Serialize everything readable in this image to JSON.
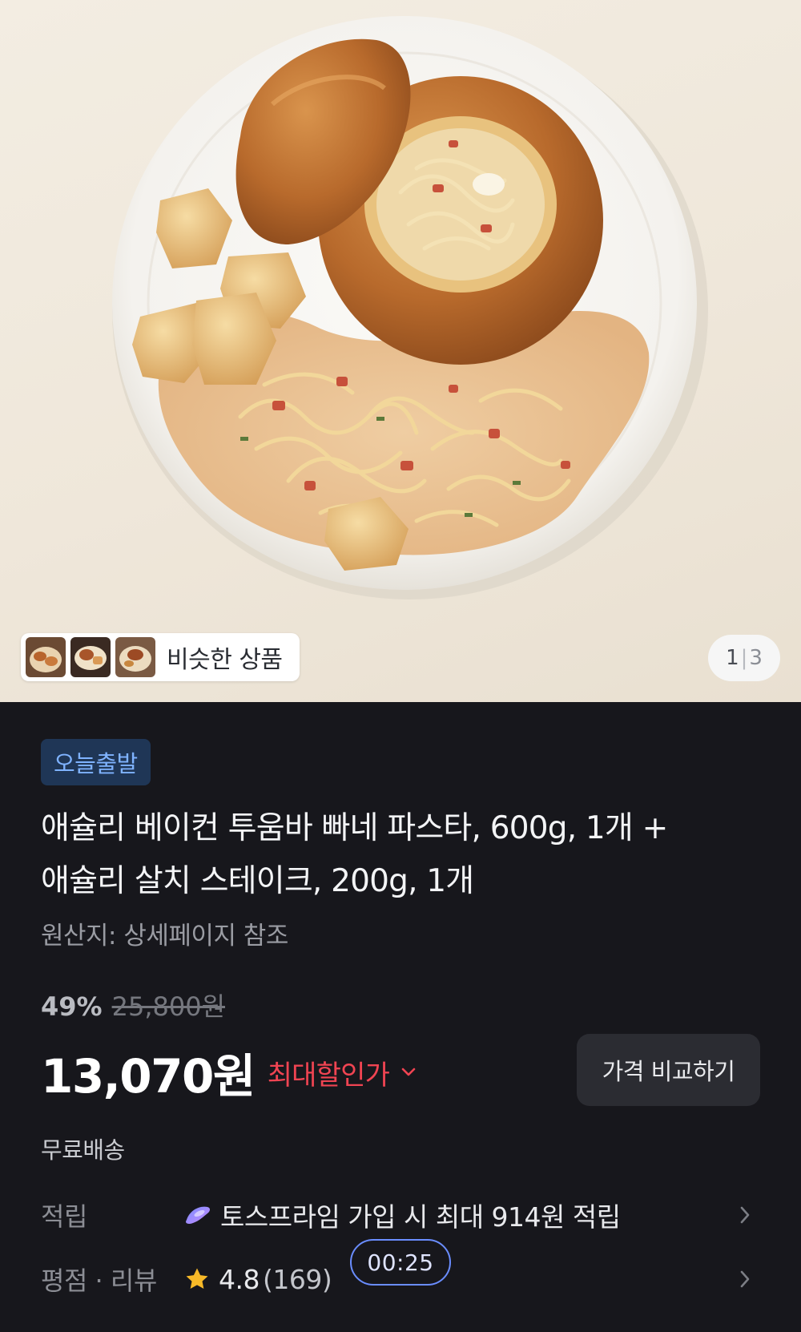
{
  "gallery": {
    "similar_label": "비슷한 상품",
    "similar_thumbs": [
      "thumb-1",
      "thumb-2",
      "thumb-3"
    ],
    "page_current": "1",
    "page_total": "3"
  },
  "product": {
    "badge": "오늘출발",
    "title_line1": "애슐리 베이컨 투움바 빠네 파스타, 600g, 1개 +",
    "title_line2": "애슐리 살치 스테이크, 200g, 1개",
    "origin": "원산지: 상세페이지 참조"
  },
  "pricing": {
    "discount_rate": "49%",
    "original_price": "25,800원",
    "price": "13,070원",
    "max_discount_label": "최대할인가",
    "compare_button": "가격 비교하기",
    "shipping": "무료배송"
  },
  "points": {
    "label": "적립",
    "text": "토스프라임 가입 시 최대 914원 적립"
  },
  "rating": {
    "label": "평점 · 리뷰",
    "score": "4.8",
    "count": "(169)"
  },
  "timer": "00:25",
  "colors": {
    "background": "#17171c",
    "badge_bg": "#1f3656",
    "badge_text": "#7fb3ff",
    "discount_red": "#f04452",
    "button_bg": "#2b2c32",
    "timer_border": "#6a8dff",
    "star": "#f7b928"
  },
  "icons": {
    "max_discount": "chevron-down-icon",
    "points_brand": "toss-prime-icon",
    "rating": "star-icon",
    "row_arrow": "chevron-right-icon"
  }
}
